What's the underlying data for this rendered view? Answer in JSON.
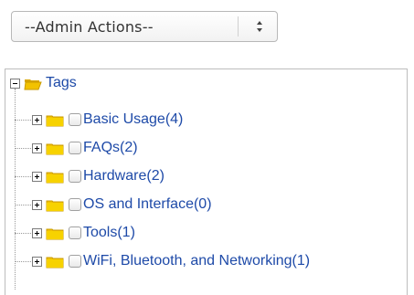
{
  "admin_actions": {
    "selected_label": "--Admin Actions--"
  },
  "tree": {
    "root": {
      "label": "Tags",
      "expanded": true
    },
    "items": [
      {
        "label": "Basic Usage(4)"
      },
      {
        "label": "FAQs(2)"
      },
      {
        "label": "Hardware(2)"
      },
      {
        "label": "OS and Interface(0)"
      },
      {
        "label": "Tools(1)"
      },
      {
        "label": "WiFi, Bluetooth, and Networking(1)"
      }
    ]
  },
  "colors": {
    "link": "#1e4aa8",
    "folder_yellow": "#f2c200",
    "folder_yellow_dark": "#d8a600"
  }
}
